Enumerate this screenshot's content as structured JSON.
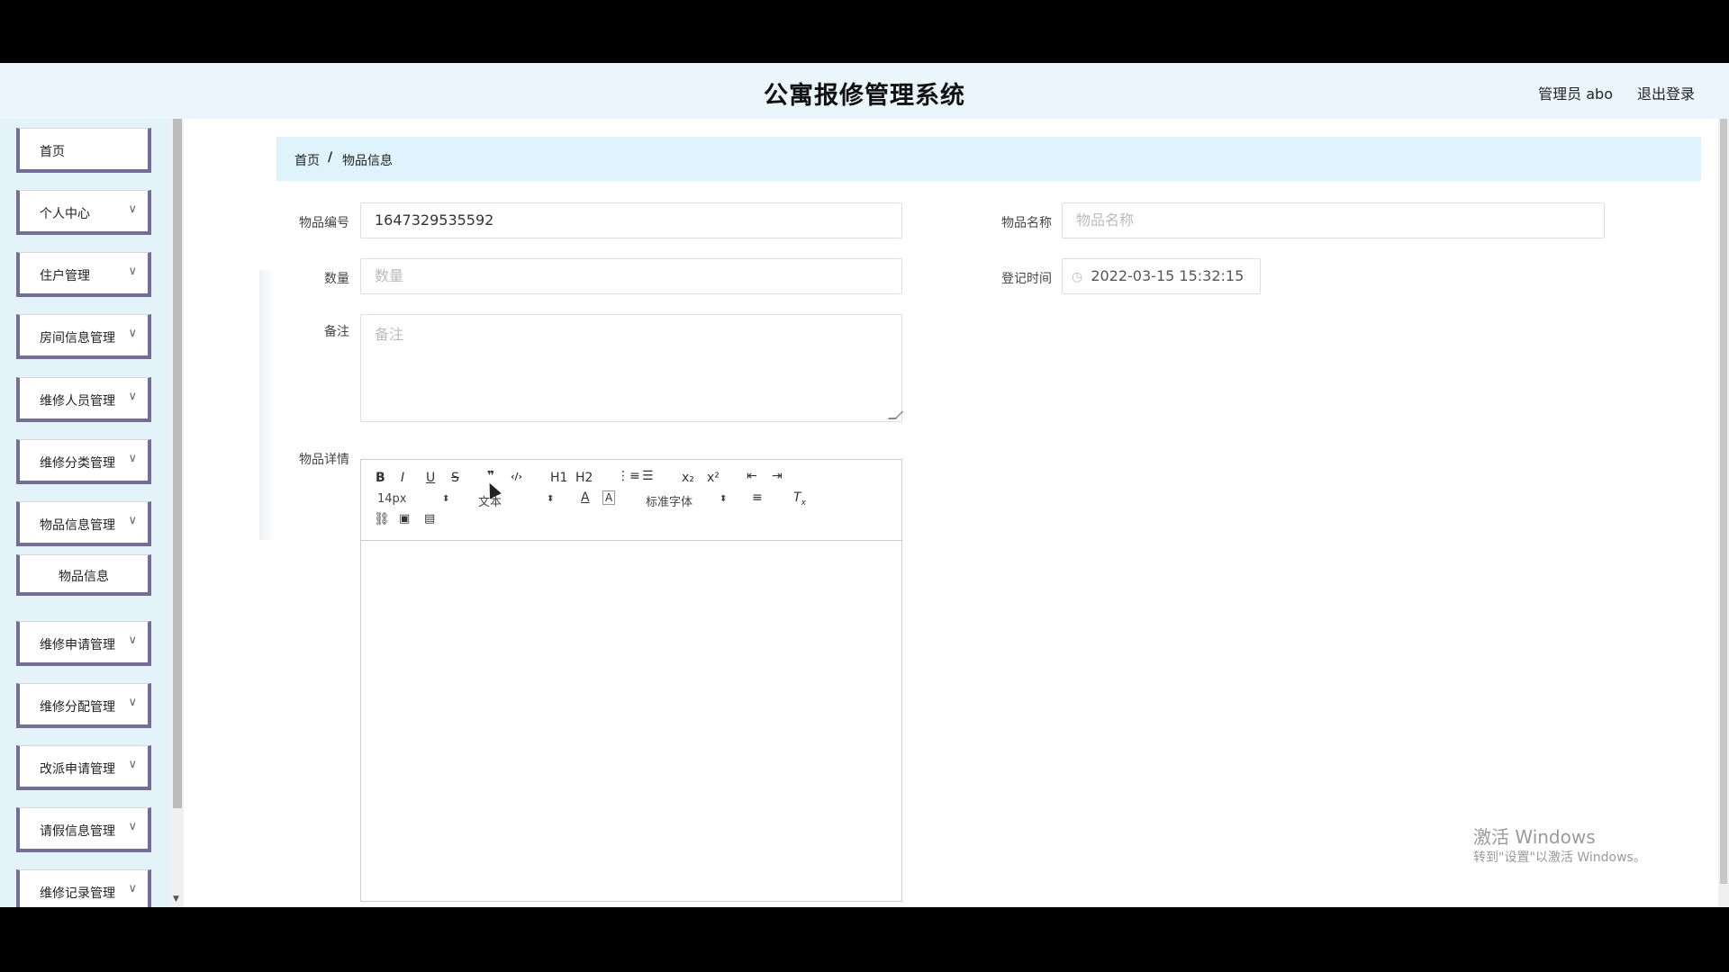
{
  "app": {
    "title": "公寓报修管理系统",
    "user": "管理员 abo",
    "logout": "退出登录"
  },
  "sidebar": {
    "items": [
      {
        "label": "首页",
        "chevron": false
      },
      {
        "label": "个人中心",
        "chevron": true
      },
      {
        "label": "住户管理",
        "chevron": true
      },
      {
        "label": "房间信息管理",
        "chevron": true
      },
      {
        "label": "维修人员管理",
        "chevron": true
      },
      {
        "label": "维修分类管理",
        "chevron": true
      },
      {
        "label": "物品信息管理",
        "chevron": true
      },
      {
        "label": "物品信息",
        "chevron": false,
        "sub": true
      },
      {
        "label": "维修申请管理",
        "chevron": true
      },
      {
        "label": "维修分配管理",
        "chevron": true
      },
      {
        "label": "改派申请管理",
        "chevron": true
      },
      {
        "label": "请假信息管理",
        "chevron": true
      },
      {
        "label": "维修记录管理",
        "chevron": true
      }
    ],
    "chevron_icon": "∨"
  },
  "breadcrumb": {
    "home": "首页",
    "sep": "/",
    "current": "物品信息"
  },
  "form": {
    "code_label": "物品编号",
    "code_value": "1647329535592",
    "name_label": "物品名称",
    "name_placeholder": "物品名称",
    "qty_label": "数量",
    "qty_placeholder": "数量",
    "time_label": "登记时间",
    "time_value": "2022-03-15 15:32:15",
    "note_label": "备注",
    "note_placeholder": "备注",
    "detail_label": "物品详情"
  },
  "editor": {
    "font_size": "14px",
    "format": "文本",
    "font_family": "标准字体",
    "buttons": [
      "B",
      "I",
      "U",
      "S",
      "❞",
      "‹/›",
      "H1",
      "H2",
      "ordered-list",
      "bullet-list",
      "x₂",
      "x²",
      "outdent",
      "indent"
    ]
  },
  "watermark": {
    "line1": "激活 Windows",
    "line2": "转到\"设置\"以激活 Windows。"
  }
}
